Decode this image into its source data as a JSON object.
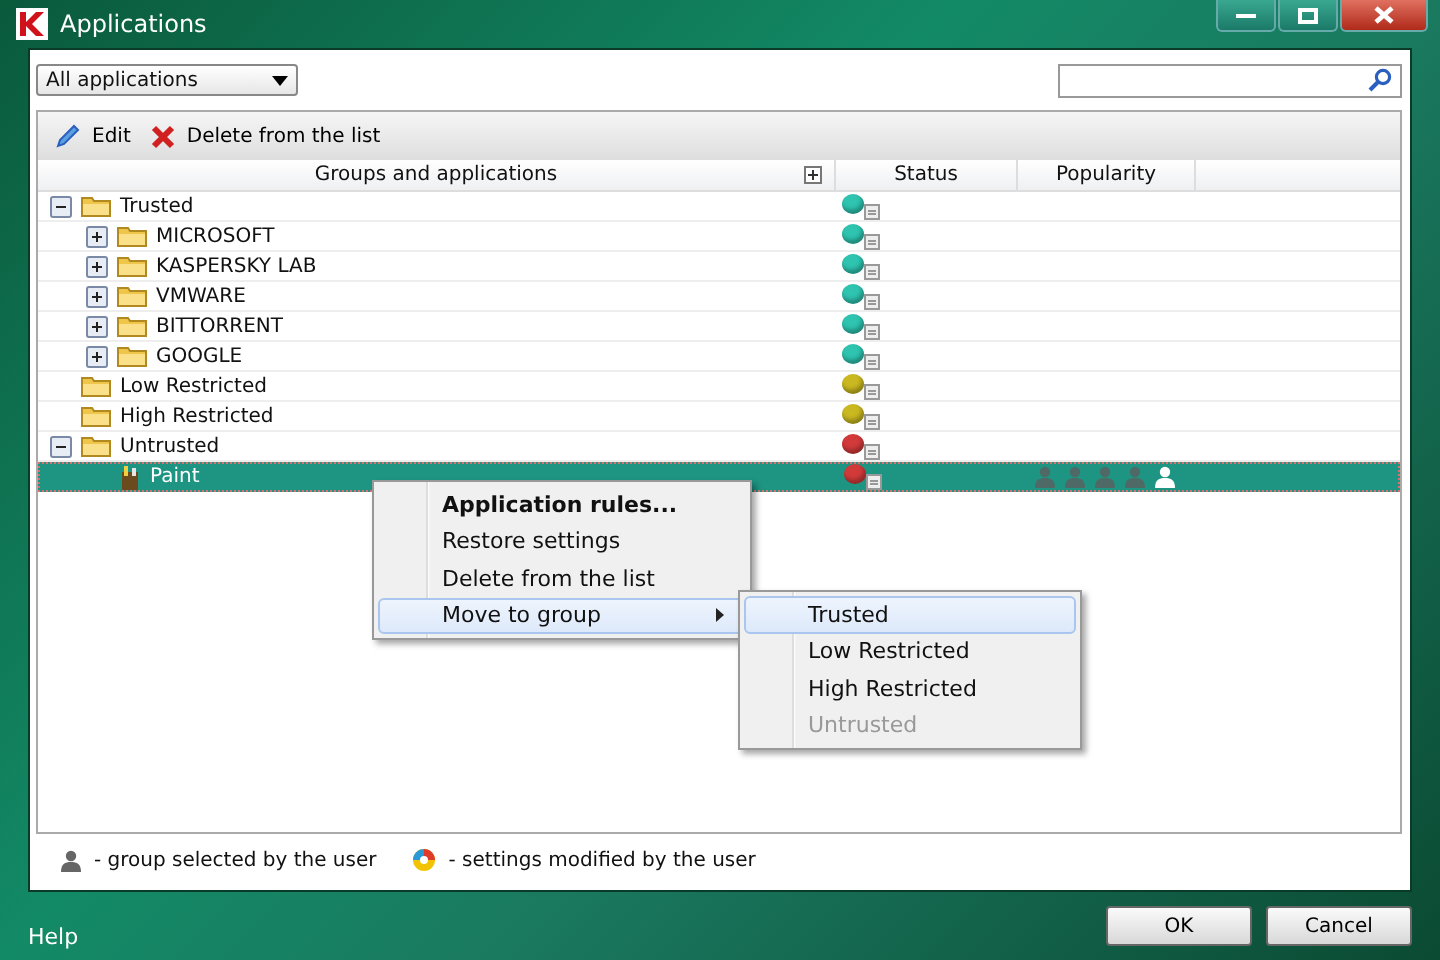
{
  "window": {
    "title": "Applications"
  },
  "filter": {
    "value": "All applications"
  },
  "toolbar": [
    {
      "kind": "edit",
      "label": "Edit"
    },
    {
      "kind": "delete",
      "label": "Delete from the list"
    }
  ],
  "table": {
    "columns": [
      "Groups and applications",
      "Status",
      "Popularity"
    ],
    "rows": [
      {
        "kind": "group",
        "label": "Trusted",
        "expanded": true,
        "color": "#2ec4b0",
        "selected": false,
        "children": [
          {
            "kind": "group",
            "label": "MICROSOFT",
            "expanded": false,
            "color": "#2ec4b0",
            "selected": false
          },
          {
            "kind": "group",
            "label": "KASPERSKY LAB",
            "expanded": false,
            "color": "#2ec4b0",
            "selected": false
          },
          {
            "kind": "group",
            "label": "VMWARE",
            "expanded": false,
            "color": "#2ec4b0",
            "selected": false
          },
          {
            "kind": "group",
            "label": "BITTORRENT",
            "expanded": false,
            "color": "#2ec4b0",
            "selected": false
          },
          {
            "kind": "group",
            "label": "GOOGLE",
            "expanded": false,
            "color": "#2ec4b0",
            "selected": false
          }
        ]
      },
      {
        "kind": "group",
        "label": "Low Restricted",
        "color": "#c9b820",
        "selected": false
      },
      {
        "kind": "group",
        "label": "High Restricted",
        "color": "#c9b820",
        "selected": false
      },
      {
        "kind": "group",
        "label": "Untrusted",
        "expanded": true,
        "color": "#d23a3a",
        "selected": false,
        "children": [
          {
            "kind": "app",
            "label": "Paint",
            "color": "#d23a3a",
            "selected": true
          }
        ]
      }
    ]
  },
  "context_menu": {
    "items": [
      {
        "label": "Application rules...",
        "default": true,
        "submenu": false,
        "selected": false
      },
      {
        "label": "Restore settings",
        "default": false,
        "submenu": false,
        "selected": false
      },
      {
        "label": "Delete from the list",
        "default": false,
        "submenu": false,
        "selected": false
      },
      {
        "label": "Move to group",
        "default": false,
        "submenu": true,
        "selected": true
      }
    ]
  },
  "submenu": {
    "items": [
      {
        "label": "Trusted",
        "selected": true,
        "disabled": false
      },
      {
        "label": "Low Restricted",
        "selected": false,
        "disabled": false
      },
      {
        "label": "High Restricted",
        "selected": false,
        "disabled": false
      },
      {
        "label": "Untrusted",
        "selected": false,
        "disabled": true
      }
    ]
  },
  "legend": [
    {
      "kind": "user",
      "label": "- group selected by the user"
    },
    {
      "kind": "modified",
      "label": "- settings modified by the user"
    }
  ],
  "footer": {
    "help": "Help",
    "buttons": [
      "OK",
      "Cancel"
    ]
  }
}
